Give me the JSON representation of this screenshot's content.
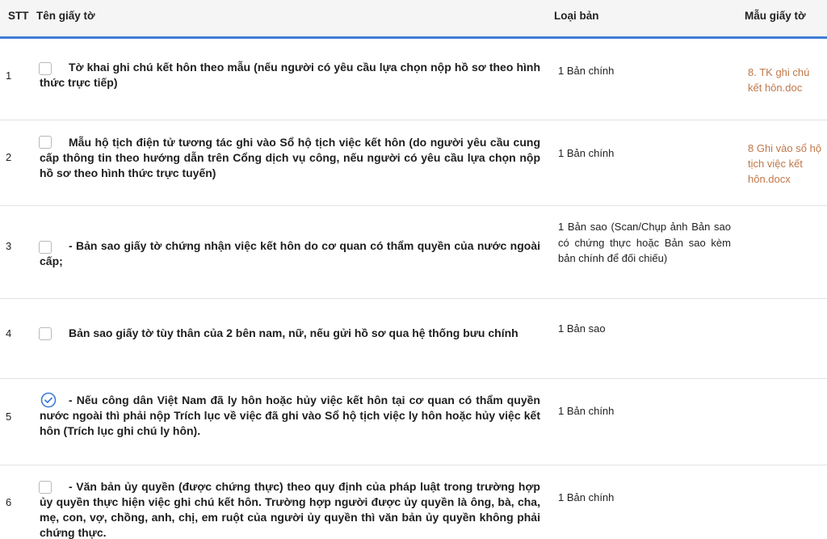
{
  "table": {
    "headers": {
      "stt": "STT",
      "name": "Tên giấy tờ",
      "type": "Loại bản",
      "template": "Mẫu giấy tờ"
    },
    "rows": [
      {
        "stt": "1",
        "checked": false,
        "name": "Tờ khai ghi chú kết hôn theo mẫu (nếu người có yêu cầu lựa chọn nộp hồ sơ theo hình thức trực tiếp)",
        "type": "1 Bản chính",
        "template": "8. TK ghi chú kết hôn.doc"
      },
      {
        "stt": "2",
        "checked": false,
        "name": "Mẫu hộ tịch điện tử tương tác ghi vào Sổ hộ tịch việc kết hôn (do người yêu cầu cung cấp thông tin theo hướng dẫn trên Cổng dịch vụ công, nếu người có yêu cầu lựa chọn nộp hồ sơ theo hình thức trực tuyến)",
        "type": "1 Bản chính",
        "template": "8 Ghi vào sổ hộ tịch việc kết hôn.docx"
      },
      {
        "stt": "3",
        "checked": false,
        "name": "- Bản sao giấy tờ chứng nhận việc kết hôn do cơ quan có thẩm quyền của nước ngoài cấp;",
        "type": "1 Bản sao (Scan/Chụp ảnh Bản sao có chứng thực hoặc Bản sao kèm bản chính để đối chiếu)",
        "template": ""
      },
      {
        "stt": "4",
        "checked": false,
        "name": "Bản sao giấy tờ tùy thân của 2 bên nam, nữ, nếu gửi hồ sơ qua hệ thống bưu chính",
        "type": "1 Bản sao",
        "template": ""
      },
      {
        "stt": "5",
        "checked": true,
        "name": "- Nếu công dân Việt Nam đã ly hôn hoặc hủy việc kết hôn tại cơ quan có thẩm quyền nước ngoài thì phải nộp Trích lục về việc đã ghi vào Sổ hộ tịch việc ly hôn hoặc hủy việc kết hôn (Trích lục ghi chú ly hôn).",
        "type": "1 Bản chính",
        "template": ""
      },
      {
        "stt": "6",
        "checked": false,
        "name": "- Văn bản ủy quyền (được chứng thực) theo quy định của pháp luật trong trường hợp ủy quyền thực hiện việc ghi chú kết hôn. Trường hợp người được ủy quyền là ông, bà, cha, mẹ, con, vợ, chồng, anh, chị, em ruột của người ủy quyền thì văn bản ủy quyền không phải chứng thực.",
        "type": "1 Bản chính",
        "template": ""
      }
    ]
  },
  "colors": {
    "header_border": "#3f7dd6",
    "link": "#c0784a",
    "check_done": "#3f7dd6"
  }
}
